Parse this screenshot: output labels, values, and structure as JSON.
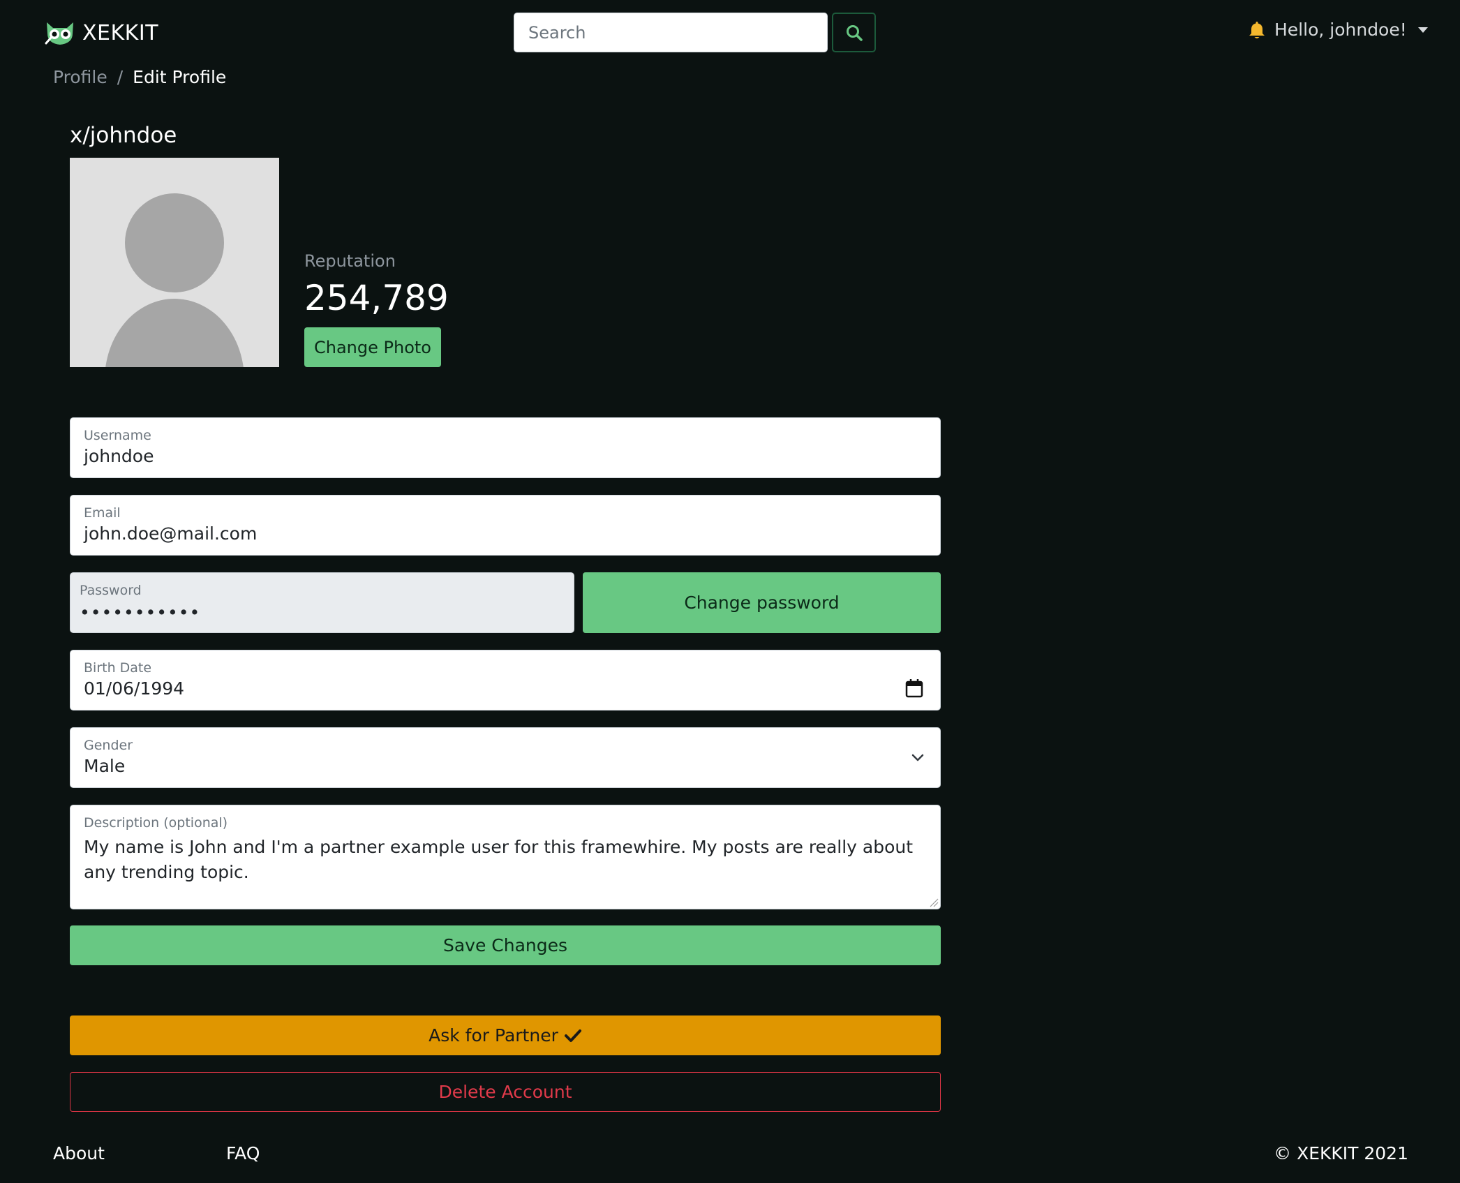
{
  "brand": {
    "name": "XEKKIT"
  },
  "search": {
    "placeholder": "Search"
  },
  "user_menu": {
    "greeting": "Hello, johndoe!"
  },
  "breadcrumb": {
    "parent": "Profile",
    "separator": "/",
    "current": "Edit Profile"
  },
  "profile": {
    "handle": "x/johndoe",
    "reputation_label": "Reputation",
    "reputation_value": "254,789",
    "change_photo_label": "Change Photo"
  },
  "form": {
    "username": {
      "label": "Username",
      "value": "johndoe"
    },
    "email": {
      "label": "Email",
      "value": "john.doe@mail.com"
    },
    "password": {
      "label": "Password",
      "value": "•••••••••••"
    },
    "change_password_label": "Change password",
    "birth_date": {
      "label": "Birth Date",
      "value": "01/06/1994"
    },
    "gender": {
      "label": "Gender",
      "value": "Male"
    },
    "description": {
      "label": "Description (optional)",
      "value": "My name is John and I'm a partner example user for this framewhire. My posts are really about any trending topic."
    },
    "save_label": "Save Changes"
  },
  "actions": {
    "partner_label": "Ask for Partner",
    "delete_label": "Delete Account"
  },
  "footer": {
    "about": "About",
    "faq": "FAQ",
    "copyright": "© XEKKIT 2021"
  },
  "colors": {
    "background": "#0b1211",
    "accent_green": "#68c883",
    "warning_orange": "#e09600",
    "danger_red": "#dc3545"
  },
  "icons": [
    "owl-logo-icon",
    "search-icon",
    "bell-icon",
    "caret-down-icon",
    "calendar-icon",
    "chevron-down-icon",
    "check-icon"
  ]
}
